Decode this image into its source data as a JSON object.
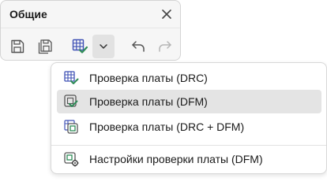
{
  "panel": {
    "title": "Общие",
    "close_icon": "close-icon",
    "toolbar": {
      "save_icon": "save-icon",
      "save_all_icon": "save-all-icon",
      "drc_icon": "board-check-icon",
      "dropdown_icon": "chevron-down-icon",
      "undo_icon": "undo-icon",
      "redo_icon": "redo-icon"
    }
  },
  "menu": {
    "items": [
      {
        "label": "Проверка платы (DRC)",
        "icon": "drc-grid-check-icon",
        "highlighted": false
      },
      {
        "label": "Проверка платы (DFM)",
        "icon": "dfm-chip-check-icon",
        "highlighted": true
      },
      {
        "label": "Проверка платы (DRC + DFM)",
        "icon": "drc-dfm-chip-icon",
        "highlighted": false
      },
      {
        "label": "Настройки проверки платы (DFM)",
        "icon": "dfm-settings-icon",
        "highlighted": false
      }
    ]
  },
  "colors": {
    "accent_blue": "#3f51b5",
    "accent_green": "#2e8b57",
    "icon_gray": "#555555",
    "disabled_gray": "#b5b5b5"
  }
}
